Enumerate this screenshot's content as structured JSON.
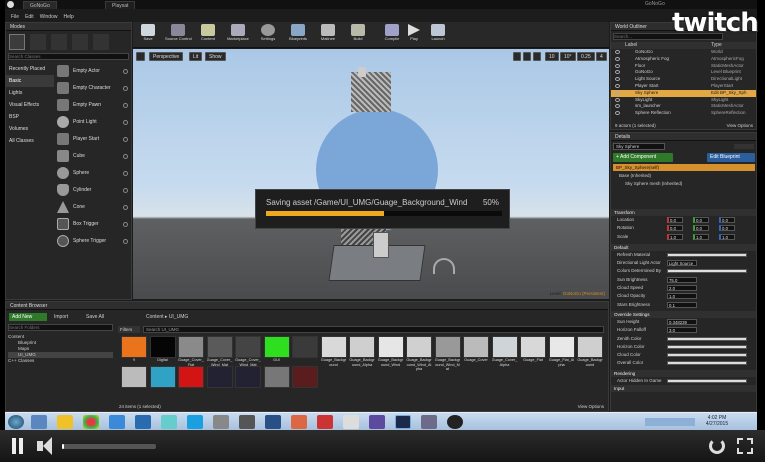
{
  "window": {
    "tab_title": "GoNoGo",
    "tab2_title": "Playsat",
    "project_name": "GoNoGo"
  },
  "menu": [
    "File",
    "Edit",
    "Window",
    "Help"
  ],
  "modes": {
    "header": "Modes",
    "search_placeholder": "Search Classes",
    "categories": [
      "Recently Placed",
      "Basic",
      "Lights",
      "Visual Effects",
      "BSP",
      "Volumes",
      "All Classes"
    ],
    "selected_category": "Basic",
    "items": [
      "Empty Actor",
      "Empty Character",
      "Empty Pawn",
      "Point Light",
      "Player Start",
      "Cube",
      "Sphere",
      "Cylinder",
      "Cone",
      "Box Trigger",
      "Sphere Trigger"
    ]
  },
  "toolbar": [
    "Save",
    "Source Control",
    "Content",
    "Marketplace",
    "Settings",
    "Blueprints",
    "Matinee",
    "Build",
    "Compile",
    "Play",
    "Launch"
  ],
  "viewport": {
    "perspective": "Perspective",
    "lit": "Lit",
    "show": "Show",
    "level_label": "Level:",
    "level_name": "GoNoGo (Persistent)",
    "camera_speed": "4",
    "grid_size": "10",
    "rotation": "10°",
    "scale": "0.25"
  },
  "saving": {
    "text": "Saving asset /Game/UI_UMG/Guage_Background_Wind",
    "percent_text": "50%",
    "progress": 0.5
  },
  "outliner": {
    "header": "World Outliner",
    "search_placeholder": "Search...",
    "col_label": "Label",
    "col_type": "Type",
    "rows": [
      {
        "label": "GoNoGo",
        "type": "World"
      },
      {
        "label": "Atmospheric Fog",
        "type": "AtmosphericFog"
      },
      {
        "label": "Floor",
        "type": "StaticMeshActor"
      },
      {
        "label": "GoNoGo",
        "type": "Level Blueprint"
      },
      {
        "label": "Light Source",
        "type": "DirectionalLight"
      },
      {
        "label": "Player Start",
        "type": "PlayerStart"
      },
      {
        "label": "Sky Sphere",
        "type": "Edit BP_Sky_Sph",
        "selected": true
      },
      {
        "label": "SkyLight",
        "type": "SkyLight"
      },
      {
        "label": "sm_launcher",
        "type": "StaticMeshActor"
      },
      {
        "label": "Sphere Reflection",
        "type": "SphereReflection"
      }
    ],
    "count": "9 actors (1 selected)",
    "view_options": "View Options"
  },
  "details": {
    "header": "Details",
    "name_value": "Sky Sphere",
    "add_component": "+ Add Component",
    "edit_blueprint": "Edit Blueprint",
    "component_self": "BP_Sky_Sphere(self)",
    "base_label": "Base (Inherited)",
    "mesh_label": "Sky Sphere mesh (Inherited)",
    "transform_header": "Transform",
    "location_label": "Location",
    "rotation_label": "Rotation",
    "scale_label": "Scale",
    "location": [
      "0.0",
      "0.0",
      "0.0"
    ],
    "rotation": [
      "0.0",
      "0.0",
      "0.0"
    ],
    "scale": [
      "1.0",
      "1.0",
      "1.0"
    ],
    "default_header": "Default",
    "props": [
      {
        "k": "Refresh Material",
        "v": ""
      },
      {
        "k": "Directional Light Actor",
        "v": "Light Source"
      },
      {
        "k": "Colors Determined By",
        "v": ""
      },
      {
        "k": "Sun Brightness",
        "v": "75.0"
      },
      {
        "k": "Cloud Speed",
        "v": "2.0"
      },
      {
        "k": "Cloud Opacity",
        "v": "1.0"
      },
      {
        "k": "Stars Brightness",
        "v": "0.1"
      }
    ],
    "override_header": "Override Settings",
    "override": [
      {
        "k": "Sun Height",
        "v": "0.348239"
      },
      {
        "k": "Horizon Falloff",
        "v": "3.0"
      },
      {
        "k": "Zenith Color",
        "v": ""
      },
      {
        "k": "Horizon Color",
        "v": ""
      },
      {
        "k": "Cloud Color",
        "v": ""
      },
      {
        "k": "Overall Color",
        "v": ""
      }
    ],
    "rendering_header": "Rendering",
    "rendering": [
      {
        "k": "Actor Hidden In Game",
        "v": ""
      }
    ],
    "input_header": "Input"
  },
  "content_browser": {
    "header": "Content Browser",
    "add_new": "Add New",
    "import": "Import",
    "save_all": "Save All",
    "search_placeholder": "Search Folders",
    "path": [
      "Content",
      "UI_UMG"
    ],
    "filters": "Filters",
    "search_assets": "Search UI_UMG",
    "tree": [
      "Content",
      "Blueprint",
      "Maps",
      "UI_UMG",
      "C++ Classes"
    ],
    "assets": [
      {
        "name": "9",
        "color": "#e9741c"
      },
      {
        "name": "Digital",
        "color": "#050505"
      },
      {
        "name": "Guage_Cover_Flat",
        "color": "#8a8a8a"
      },
      {
        "name": "Guage_Cover_Wind_Mat",
        "color": "#5a5a5a"
      },
      {
        "name": "Guage_Cover_Wind_Mat",
        "color": "#444"
      },
      {
        "name": "GUI",
        "color": "#2ddf1e"
      },
      {
        "name": "",
        "color": "#3a3a3a"
      },
      {
        "name": "Guage_Background",
        "color": "#d9d9d9"
      },
      {
        "name": "Guage_Background_Alpha",
        "color": "#cfcfcf"
      },
      {
        "name": "Guage_Background_Wind",
        "color": "#e6e6e6"
      },
      {
        "name": "Guage_Background_Wind_Alpha",
        "color": "#d0d0d0"
      },
      {
        "name": "Guage_Background_Wind_Mat",
        "color": "#999"
      },
      {
        "name": "Guage_Cover",
        "color": "#bbb"
      },
      {
        "name": "Guage_Cover_Alpha",
        "color": "#cfd4d8"
      },
      {
        "name": "Guage_Flat",
        "color": "#d8d8d8"
      },
      {
        "name": "Guage_Flat_Alpha",
        "color": "#e8e8e8"
      },
      {
        "name": "Guage_Background",
        "color": "#cfcfcf"
      },
      {
        "name": "",
        "color": "#bbb"
      },
      {
        "name": "",
        "color": "#2fa2c6"
      },
      {
        "name": "",
        "color": "#d21414"
      },
      {
        "name": "",
        "color": "#223"
      },
      {
        "name": "",
        "color": "#223"
      },
      {
        "name": "",
        "color": "#777"
      },
      {
        "name": "",
        "color": "#5a1c1c"
      }
    ],
    "count": "24 items (1 selected)",
    "view_options": "View Options"
  },
  "tray": {
    "time": "4:02 PM",
    "date": "4/27/2015"
  },
  "twitch": {
    "logo": "twitch",
    "progress": 0.02
  }
}
